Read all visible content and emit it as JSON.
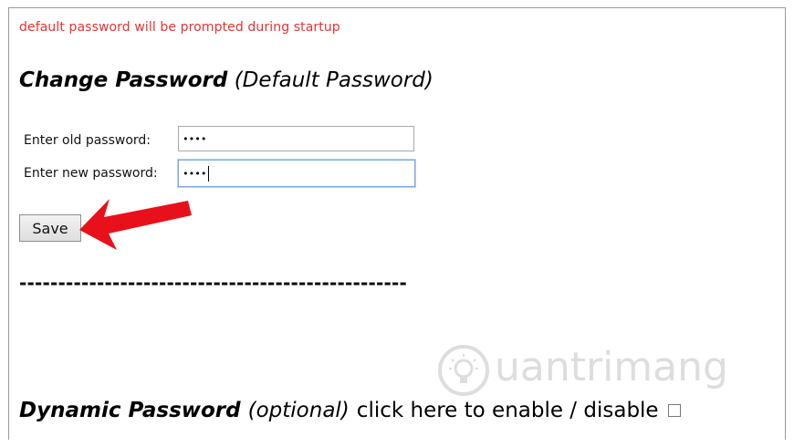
{
  "notice": "default password will be prompted during startup",
  "change_password": {
    "title": "Change Password",
    "subtitle": "(Default Password)",
    "old_label": "Enter old password:",
    "old_value": "••••",
    "new_label": "Enter new password:",
    "new_value": "••••",
    "save_label": "Save"
  },
  "divider": "--------------------------------------------------",
  "dynamic_password": {
    "title": "Dynamic Password",
    "optional": "(optional)",
    "action": "click here to enable / disable",
    "checked": false
  },
  "watermark": {
    "text": "uantrimang",
    "logo_icon": "lightbulb-icon"
  },
  "colors": {
    "notice": "#e53333",
    "arrow": "#e8101a",
    "focus_border": "#7aa7e0"
  }
}
